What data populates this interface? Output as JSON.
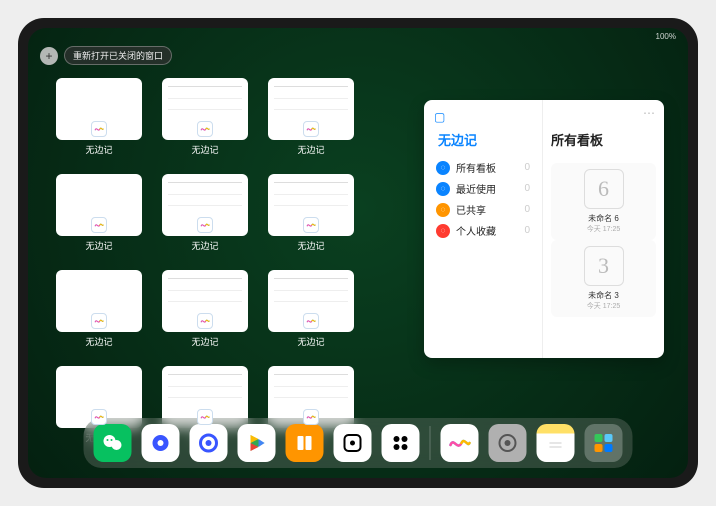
{
  "status_text": "100%",
  "reopen_label": "重新打开已关闭的窗口",
  "window_app_label": "无边记",
  "panel": {
    "left_title": "无边记",
    "right_title": "所有看板",
    "items": [
      {
        "label": "所有看板",
        "count": "0",
        "color": "#0a84ff"
      },
      {
        "label": "最近使用",
        "count": "0",
        "color": "#0a84ff"
      },
      {
        "label": "已共享",
        "count": "0",
        "color": "#ff9500"
      },
      {
        "label": "个人收藏",
        "count": "0",
        "color": "#ff3b30"
      }
    ],
    "boards": [
      {
        "glyph": "6",
        "name": "未命名 6",
        "time": "今天 17:25"
      },
      {
        "glyph": "3",
        "name": "未命名 3",
        "time": "今天 17:25"
      }
    ]
  },
  "dock_apps": [
    "wechat",
    "quark-hd",
    "quark",
    "play",
    "books",
    "dice",
    "camera-kit",
    "freeform",
    "settings",
    "notes",
    "app-library"
  ]
}
